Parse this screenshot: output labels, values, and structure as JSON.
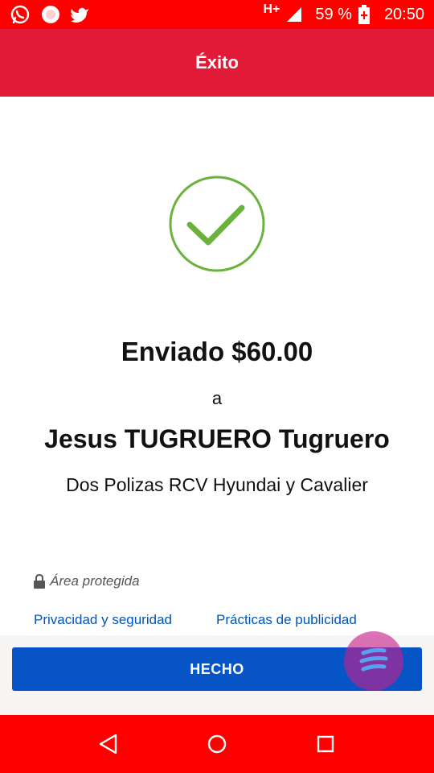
{
  "status_bar": {
    "icons": [
      "whatsapp-icon",
      "circle-notification-icon",
      "twitter-icon"
    ],
    "network": "H+",
    "battery": "59 %",
    "time": "20:50"
  },
  "app_bar": {
    "title": "Éxito"
  },
  "receipt": {
    "amount_text": "Enviado $60.00",
    "to_text": "a",
    "recipient": "Jesus TUGRUERO Tugruero",
    "concept": "Dos Polizas RCV Hyundai y Cavalier"
  },
  "security": {
    "protected_label": "Área protegida",
    "privacy_link": "Privacidad y seguridad",
    "ads_link": "Prácticas de publicidad"
  },
  "actions": {
    "done_label": "HECHO"
  },
  "nav_bar": {
    "icons": [
      "back-icon",
      "home-icon",
      "recents-icon"
    ]
  },
  "colors": {
    "status_bar": "#ff0000",
    "app_bar": "#e31a37",
    "check_green": "#6ab23c",
    "button_blue": "#0654c6",
    "link_blue": "#0055b8"
  }
}
